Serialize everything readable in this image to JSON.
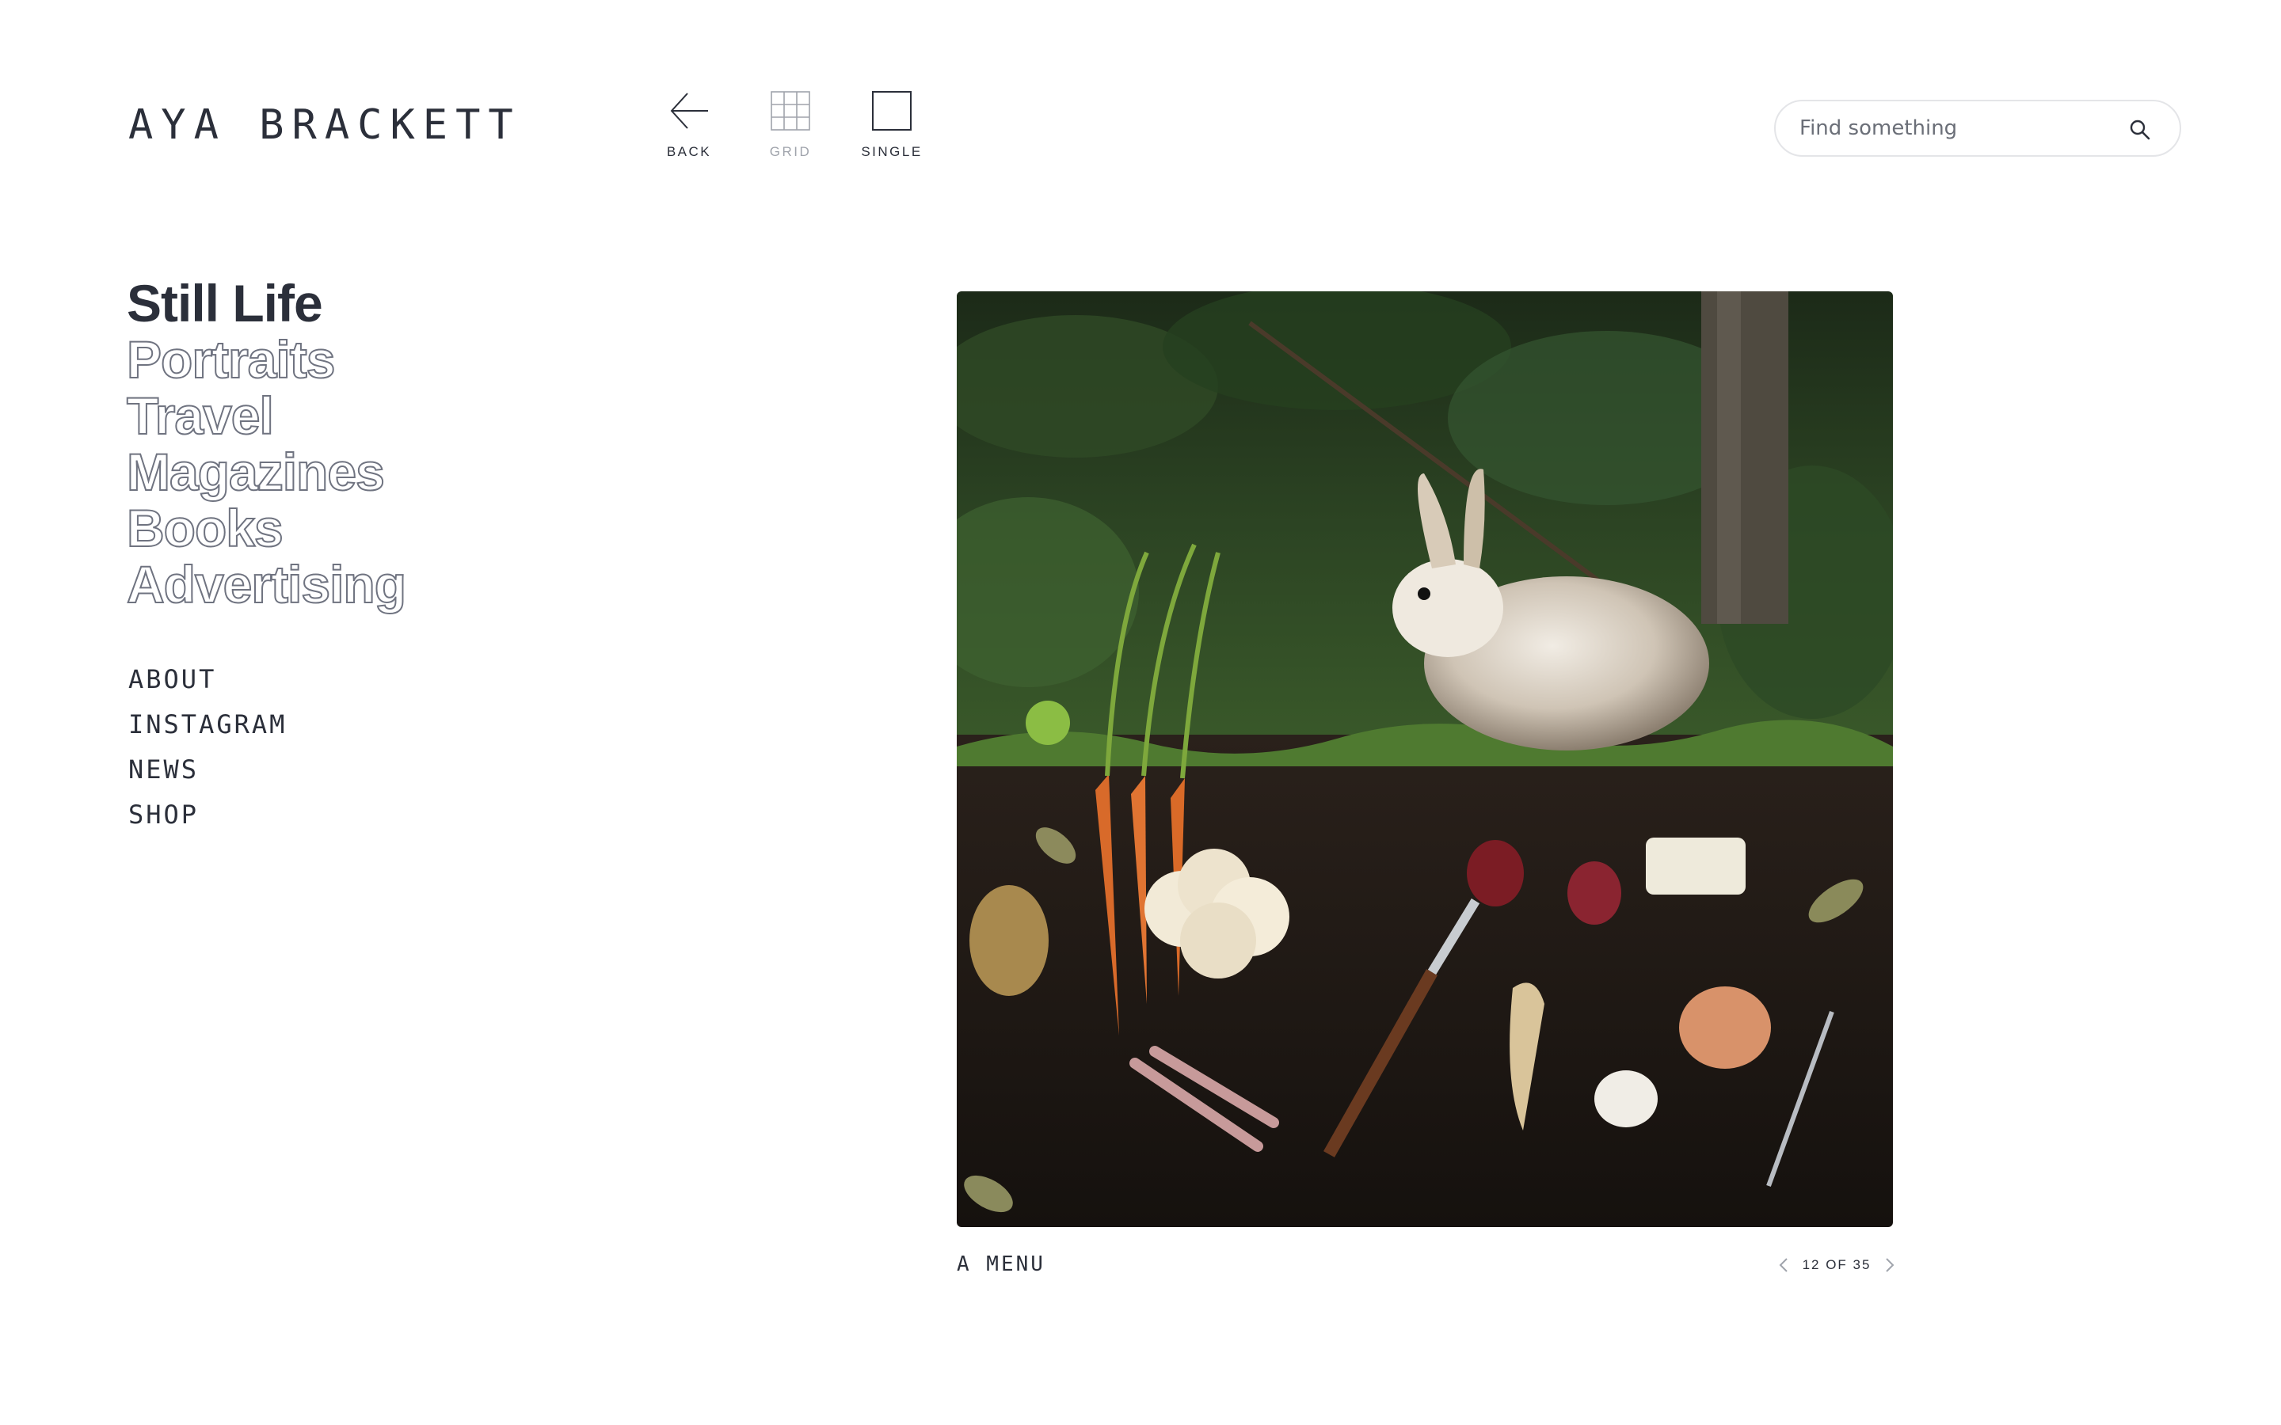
{
  "site": {
    "title": "AYA BRACKETT"
  },
  "view_controls": [
    {
      "label": "BACK",
      "icon": "back-arrow-icon",
      "state": "normal"
    },
    {
      "label": "GRID",
      "icon": "grid-icon",
      "state": "dimmed"
    },
    {
      "label": "SINGLE",
      "icon": "single-square-icon",
      "state": "normal"
    }
  ],
  "search": {
    "placeholder": "Find something",
    "value": "",
    "icon": "search-icon"
  },
  "categories": [
    {
      "label": "Still Life",
      "active": true
    },
    {
      "label": "Portraits",
      "active": false
    },
    {
      "label": "Travel",
      "active": false
    },
    {
      "label": "Magazines",
      "active": false
    },
    {
      "label": "Books",
      "active": false
    },
    {
      "label": "Advertising",
      "active": false
    }
  ],
  "secondary_links": [
    "ABOUT",
    "INSTAGRAM",
    "NEWS",
    "SHOP"
  ],
  "image": {
    "caption": "A MENU"
  },
  "pager": {
    "label": "12 OF 35",
    "current": 12,
    "total": 35
  },
  "colors": {
    "text": "#2b2f3a",
    "outline": "#6f7380",
    "dimmed": "#a0a4ac",
    "search_border": "#e4e5e8"
  }
}
